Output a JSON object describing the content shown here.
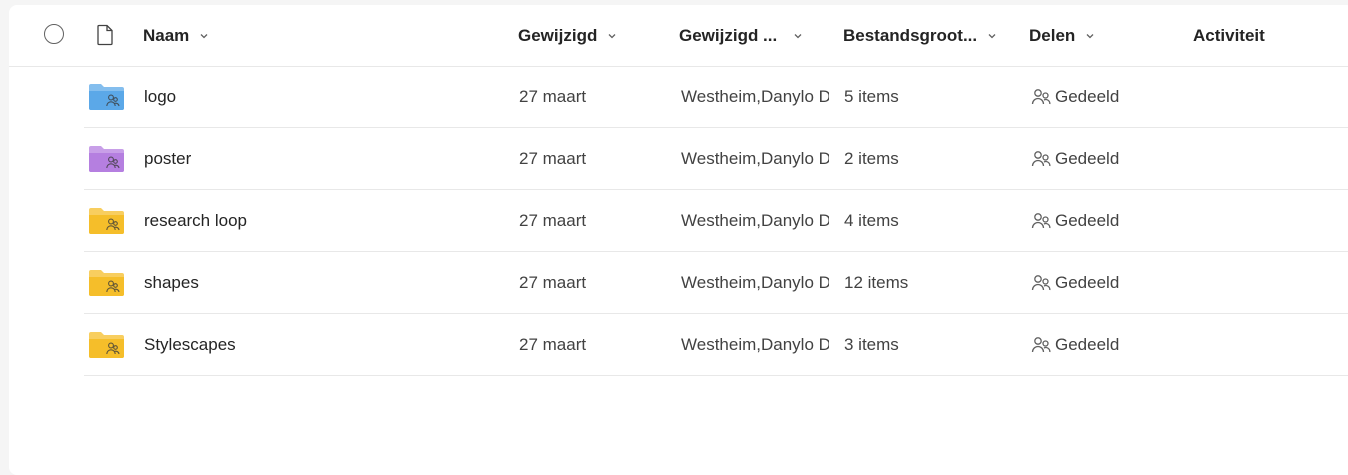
{
  "columns": {
    "name": "Naam",
    "modified": "Gewijzigd",
    "modified_by": "Gewijzigd ...",
    "file_size": "Bestandsgroot...",
    "sharing": "Delen",
    "activity": "Activiteit"
  },
  "rows": [
    {
      "name": "logo",
      "modified": "27 maart",
      "modified_by": "Westheim,Danylo D",
      "size": "5 items",
      "sharing": "Gedeeld",
      "folder_color": "#5ba8e8"
    },
    {
      "name": "poster",
      "modified": "27 maart",
      "modified_by": "Westheim,Danylo D",
      "size": "2 items",
      "sharing": "Gedeeld",
      "folder_color": "#b57fe0"
    },
    {
      "name": "research loop",
      "modified": "27 maart",
      "modified_by": "Westheim,Danylo D",
      "size": "4 items",
      "sharing": "Gedeeld",
      "folder_color": "#f5be2a"
    },
    {
      "name": "shapes",
      "modified": "27 maart",
      "modified_by": "Westheim,Danylo D",
      "size": "12 items",
      "sharing": "Gedeeld",
      "folder_color": "#f5be2a"
    },
    {
      "name": "Stylescapes",
      "modified": "27 maart",
      "modified_by": "Westheim,Danylo D",
      "size": "3 items",
      "sharing": "Gedeeld",
      "folder_color": "#f5be2a"
    }
  ],
  "icons": {
    "select_all": "select-all-circle-icon",
    "file_type": "document-icon",
    "folder": "shared-folder-icon",
    "shared": "people-icon",
    "sort": "chevron-down-icon"
  }
}
